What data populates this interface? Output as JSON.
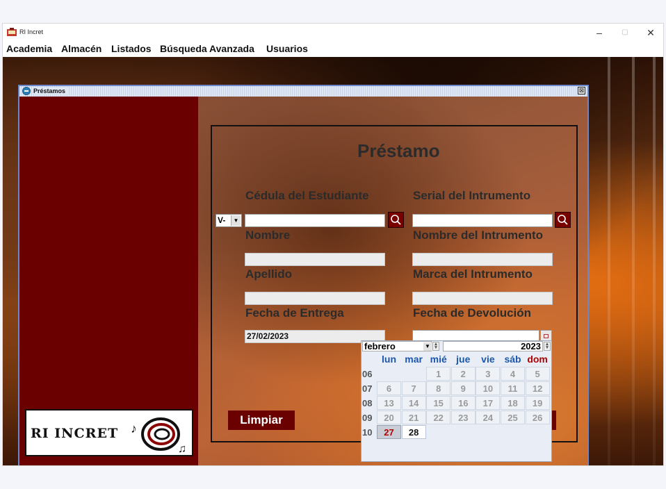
{
  "window": {
    "title": "RI Incret",
    "min": "–",
    "max": "▢",
    "close": "✕"
  },
  "menu": [
    "Academia",
    "Almacén",
    "Listados",
    "Búsqueda Avanzada",
    "Usuarios"
  ],
  "dialog": {
    "title": "Préstamos",
    "close": "⊠"
  },
  "logo": {
    "text": "RI INCRET"
  },
  "form": {
    "heading": "Préstamo",
    "cedula_label": "Cédula del Estudiante",
    "cedula_prefix": "V-",
    "cedula_value": "",
    "serial_label": "Serial del Intrumento",
    "serial_value": "",
    "nombre_label": "Nombre",
    "nombre_value": "",
    "nombre_instr_label": "Nombre del Intrumento",
    "nombre_instr_value": "",
    "apellido_label": "Apellido",
    "apellido_value": "",
    "marca_label": "Marca del Intrumento",
    "marca_value": "",
    "fecha_entrega_label": "Fecha de Entrega",
    "fecha_entrega_value": "27/02/2023",
    "fecha_dev_label": "Fecha de Devolución",
    "fecha_dev_value": "",
    "limpiar_label": "Limpiar"
  },
  "calendar": {
    "month": "febrero",
    "year": "2023",
    "day_names": [
      "lun",
      "mar",
      "mié",
      "jue",
      "vie",
      "sáb",
      "dom"
    ],
    "weeks": [
      {
        "num": "06",
        "days": [
          "",
          "",
          "1",
          "2",
          "3",
          "4",
          "5"
        ]
      },
      {
        "num": "07",
        "days": [
          "6",
          "7",
          "8",
          "9",
          "10",
          "11",
          "12"
        ]
      },
      {
        "num": "08",
        "days": [
          "13",
          "14",
          "15",
          "16",
          "17",
          "18",
          "19"
        ]
      },
      {
        "num": "09",
        "days": [
          "20",
          "21",
          "22",
          "23",
          "24",
          "25",
          "26"
        ]
      },
      {
        "num": "10",
        "days": [
          "27",
          "28",
          "",
          "",
          "",
          "",
          ""
        ]
      }
    ]
  }
}
